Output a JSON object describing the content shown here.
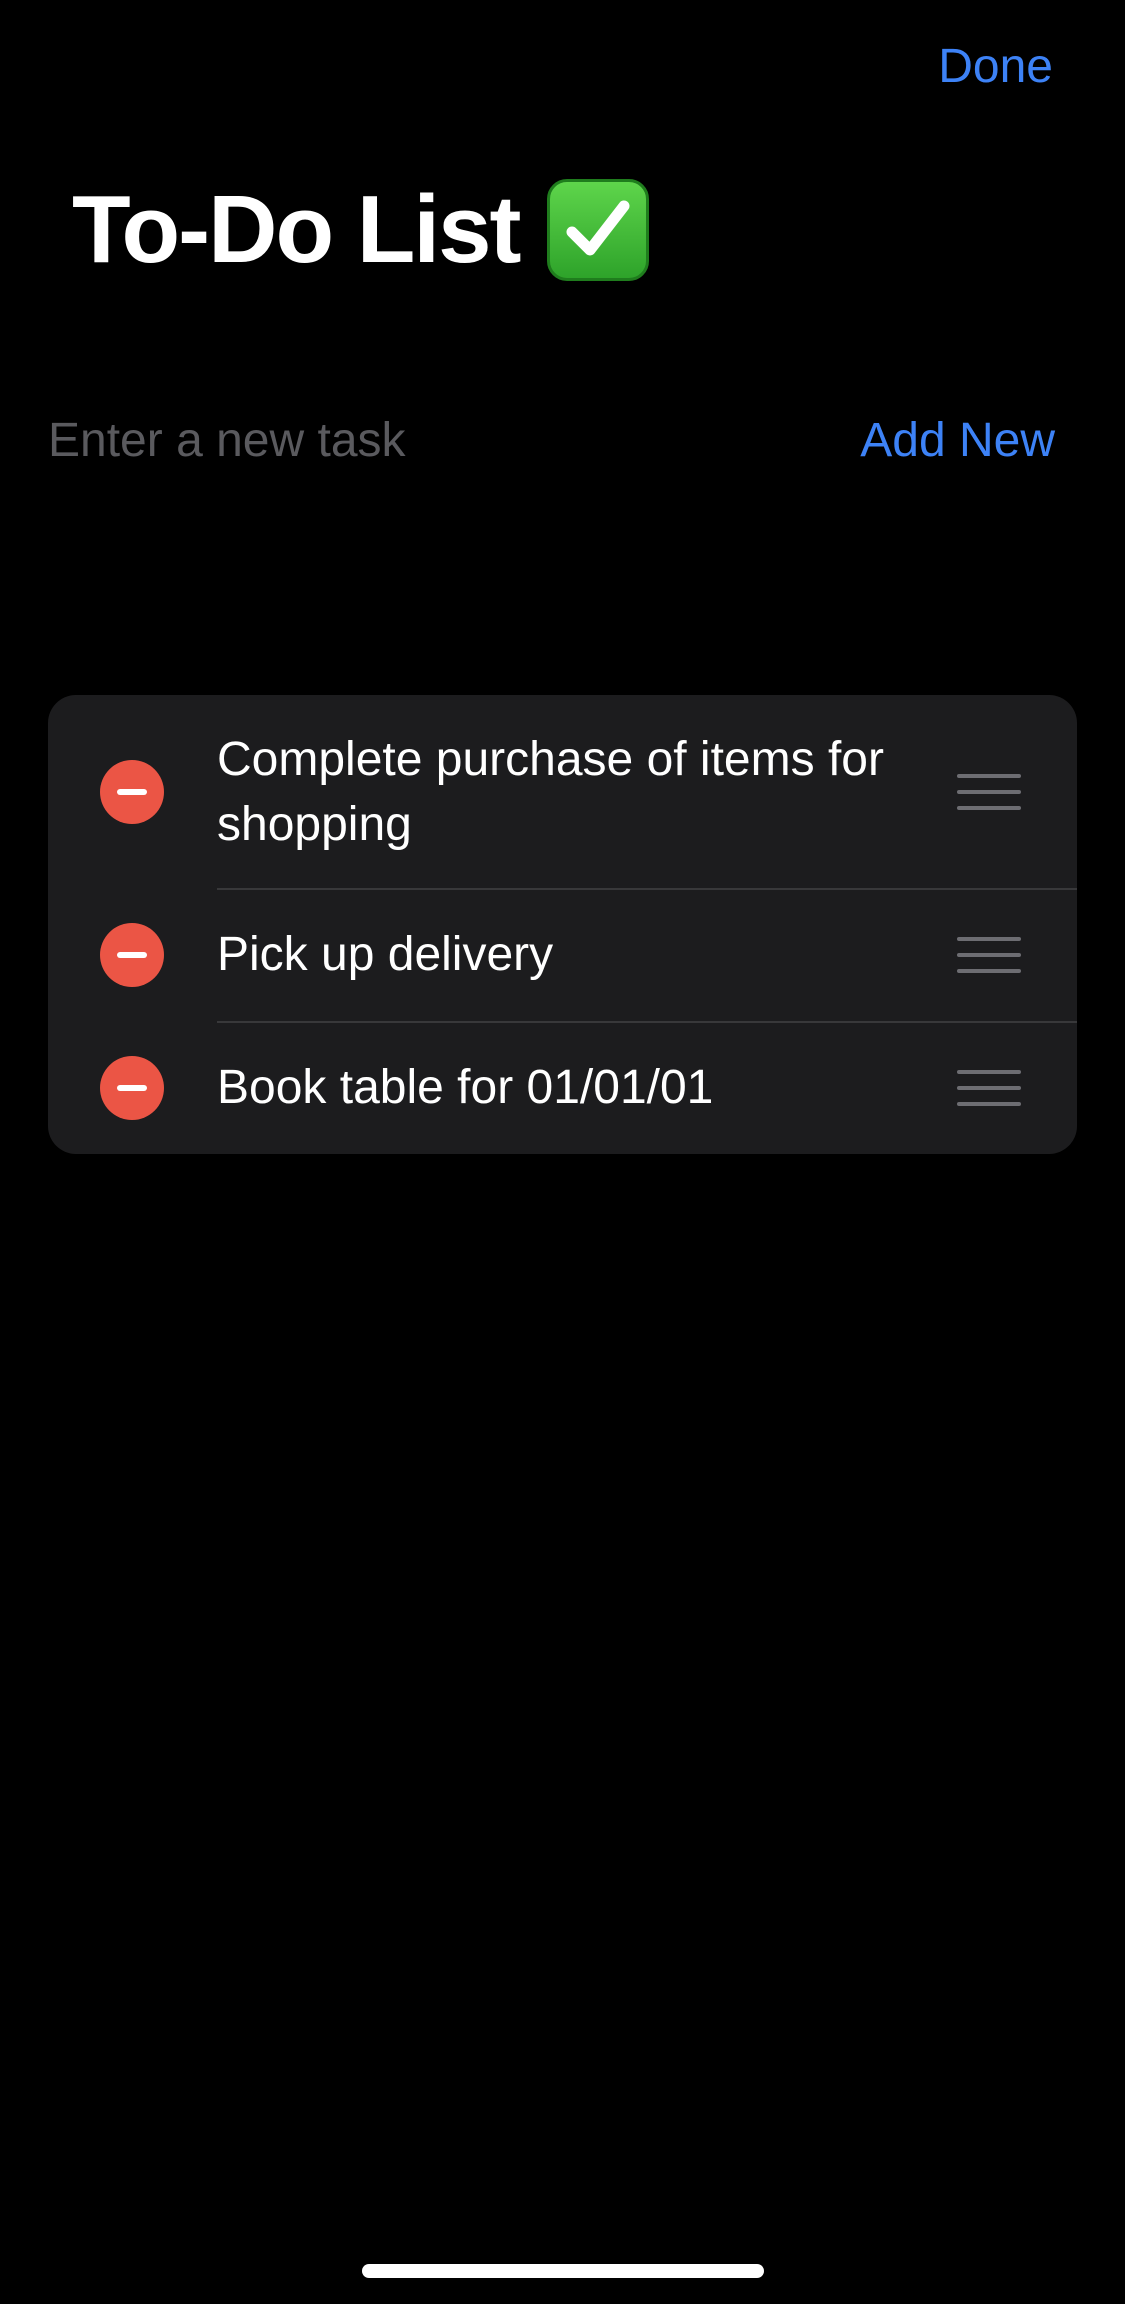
{
  "header": {
    "done_label": "Done",
    "title": "To-Do List",
    "title_icon": "check-mark-button-emoji"
  },
  "new_task": {
    "placeholder": "Enter a new task",
    "value": "",
    "add_label": "Add New"
  },
  "tasks": [
    {
      "label": "Complete purchase of items for shopping"
    },
    {
      "label": "Pick up delivery"
    },
    {
      "label": "Book table for 01/01/01"
    }
  ],
  "icons": {
    "delete": "remove-circle-icon",
    "reorder": "reorder-handle-icon"
  },
  "colors": {
    "accent": "#3d82f6",
    "destructive": "#eb5545",
    "background": "#000000",
    "card": "#1c1c1e"
  }
}
